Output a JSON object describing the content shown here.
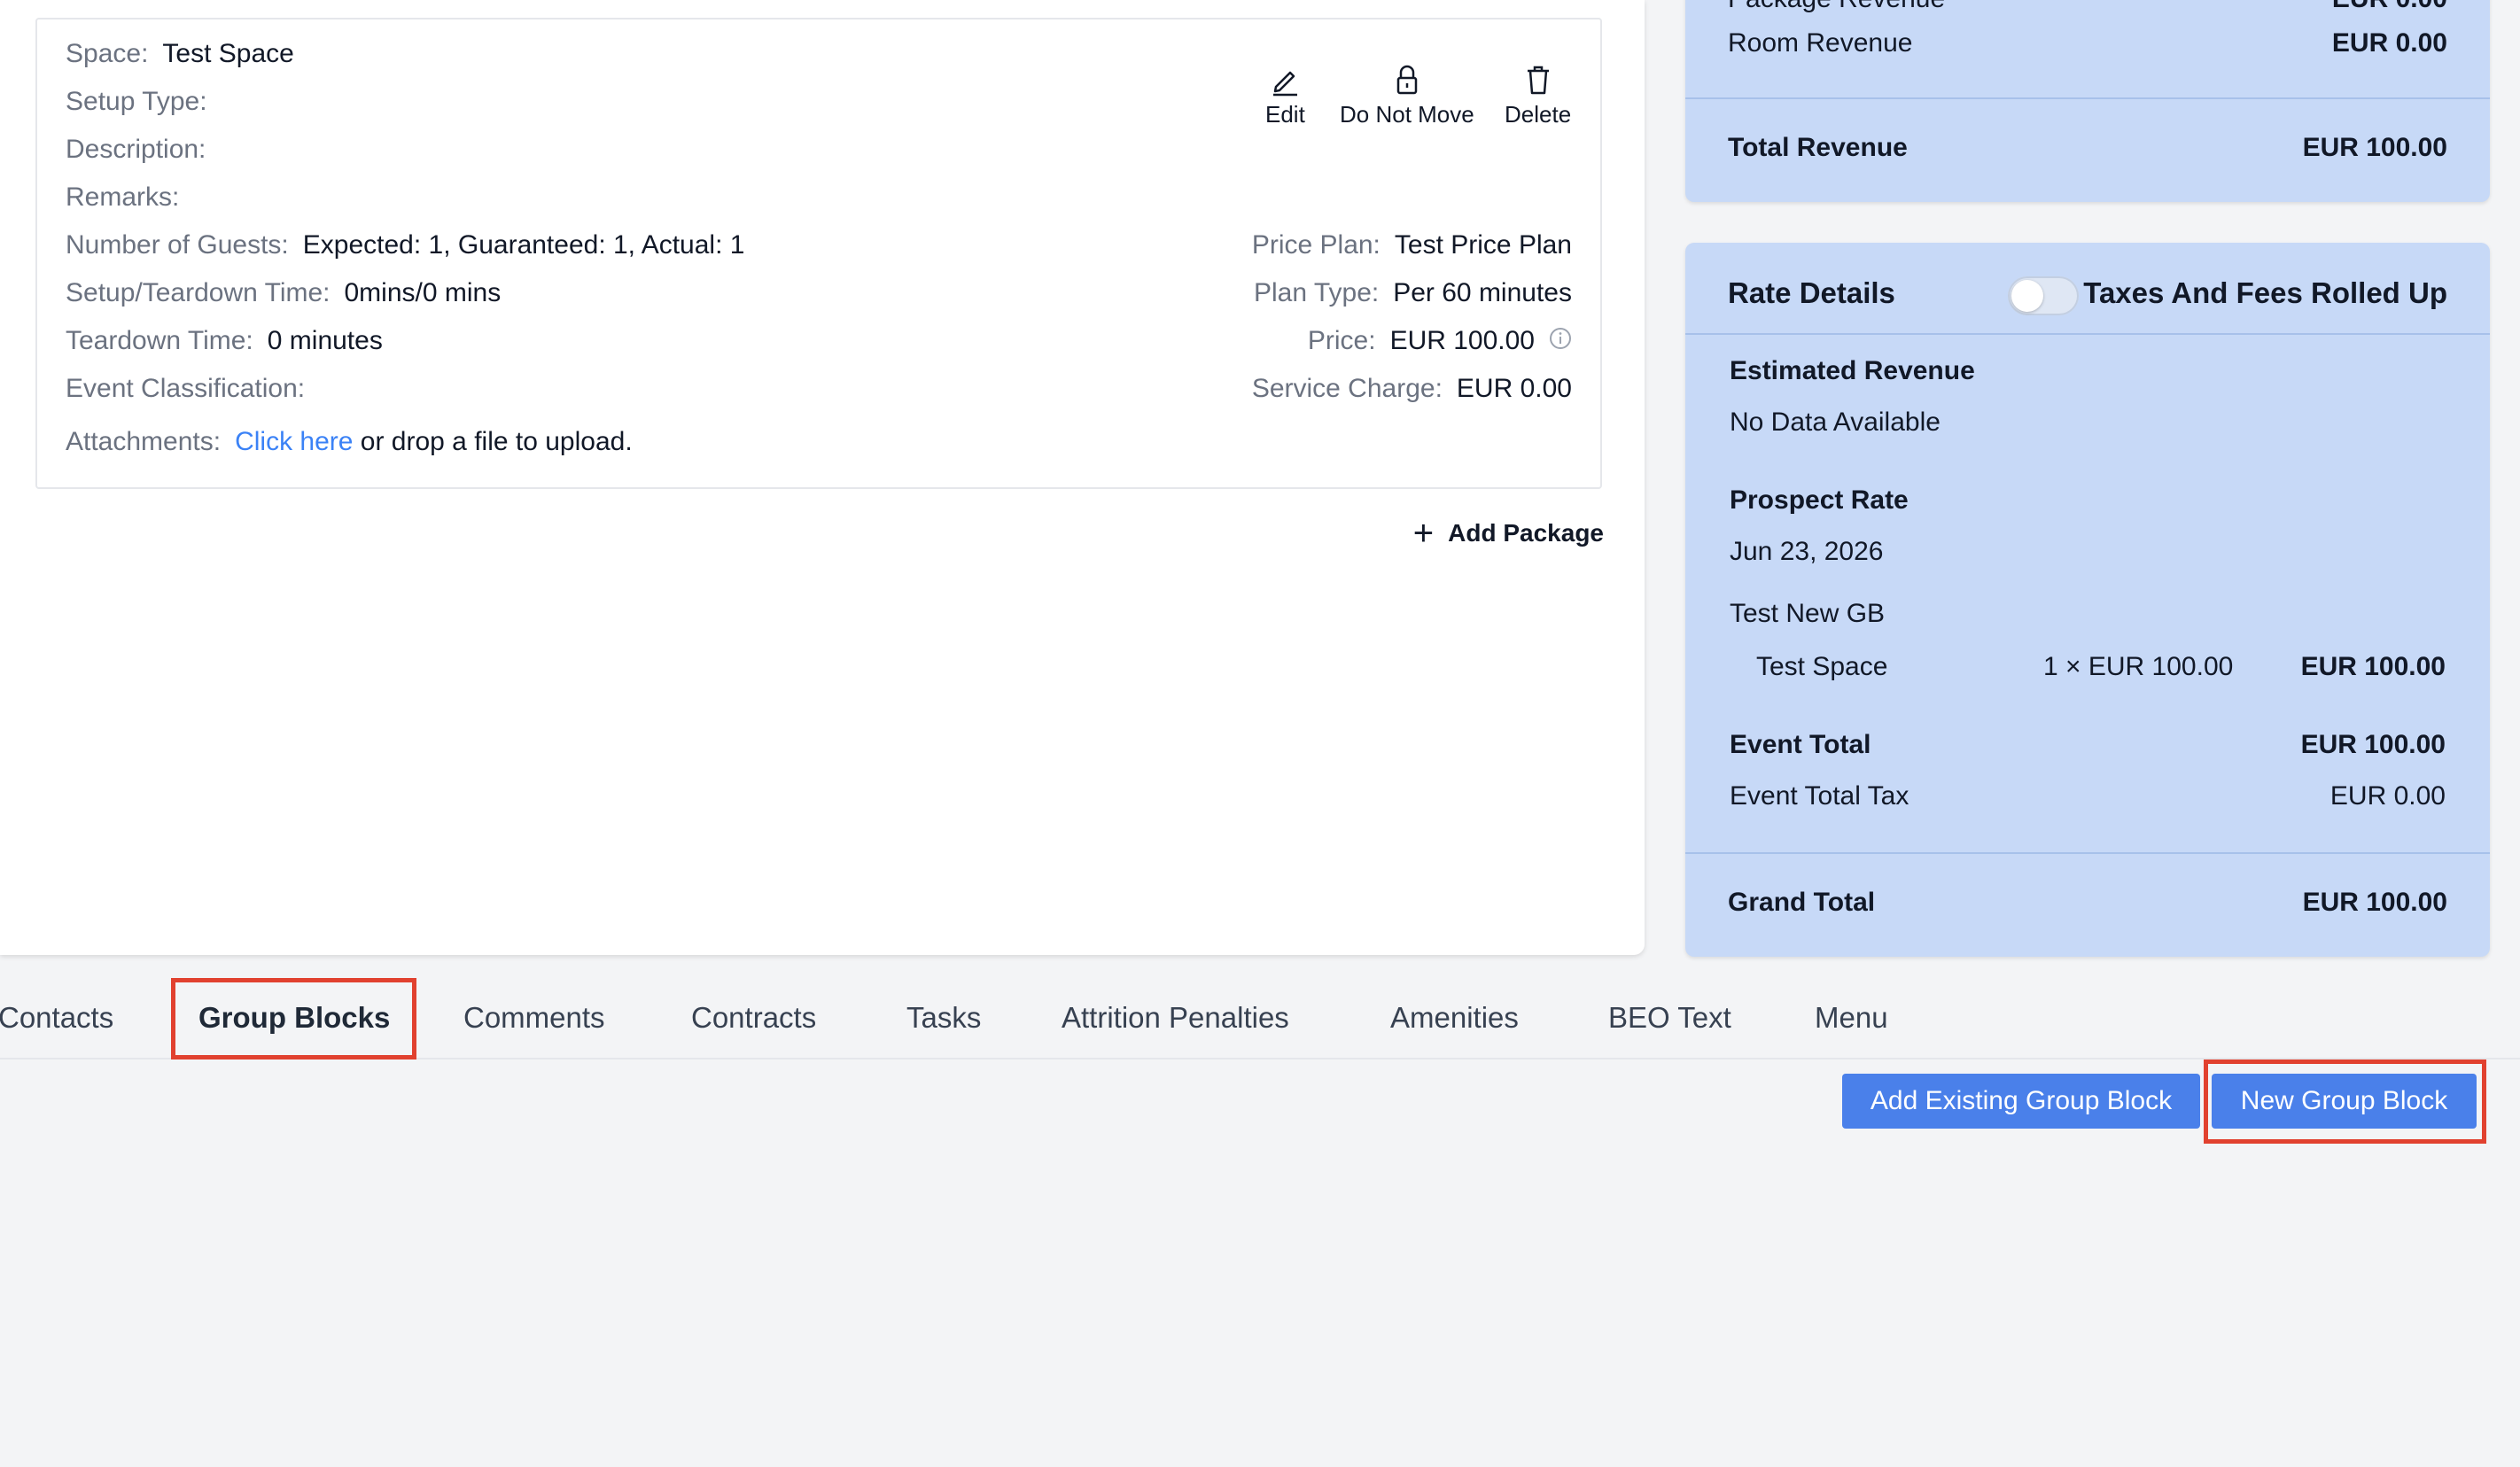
{
  "event": {
    "space_label": "Space:",
    "space_value": "Test Space",
    "setup_type_label": "Setup Type:",
    "description_label": "Description:",
    "remarks_label": "Remarks:",
    "guests_label": "Number of Guests:",
    "guests_value": "Expected: 1, Guaranteed: 1, Actual: 1",
    "setup_teardown_label": "Setup/Teardown Time:",
    "setup_teardown_value": "0mins/0 mins",
    "teardown_label": "Teardown Time:",
    "teardown_value": "0 minutes",
    "classification_label": "Event Classification:",
    "attachments_label": "Attachments:",
    "attachments_link": "Click here",
    "attachments_suffix": "or drop a file to upload.",
    "price_plan_label": "Price Plan:",
    "price_plan_value": "Test Price Plan",
    "plan_type_label": "Plan Type:",
    "plan_type_value": "Per 60 minutes",
    "price_label": "Price:",
    "price_value": "EUR 100.00",
    "service_charge_label": "Service Charge:",
    "service_charge_value": "EUR 0.00",
    "actions": {
      "edit": "Edit",
      "do_not_move": "Do Not Move",
      "delete": "Delete"
    },
    "add_package": "Add Package"
  },
  "revenue": {
    "package_label": "Package Revenue",
    "package_value": "EUR 0.00",
    "room_label": "Room Revenue",
    "room_value": "EUR 0.00",
    "total_label": "Total Revenue",
    "total_value": "EUR 100.00"
  },
  "rate_details": {
    "title": "Rate Details",
    "toggle_label": "Taxes And Fees Rolled Up",
    "toggle_on": false,
    "estimated_revenue_label": "Estimated Revenue",
    "estimated_revenue_value": "No Data Available",
    "prospect_rate_label": "Prospect Rate",
    "prospect_date": "Jun 23, 2026",
    "group_name": "Test New GB",
    "line_item": {
      "name": "Test Space",
      "qty": "1 × EUR 100.00",
      "amount": "EUR 100.00"
    },
    "event_total_label": "Event Total",
    "event_total_value": "EUR 100.00",
    "event_tax_label": "Event Total Tax",
    "event_tax_value": "EUR 0.00",
    "grand_total_label": "Grand Total",
    "grand_total_value": "EUR 100.00"
  },
  "tabs": [
    {
      "label": "Contacts"
    },
    {
      "label": "Group Blocks",
      "active": true
    },
    {
      "label": "Comments"
    },
    {
      "label": "Contracts"
    },
    {
      "label": "Tasks"
    },
    {
      "label": "Attrition Penalties"
    },
    {
      "label": "Amenities"
    },
    {
      "label": "BEO Text"
    },
    {
      "label": "Menu"
    }
  ],
  "buttons": {
    "add_existing": "Add Existing Group Block",
    "new_group_block": "New Group Block"
  },
  "colors": {
    "accent": "#4a80ea",
    "panel": "#c7d9f7",
    "highlight": "#e1412f",
    "link": "#3b82f6"
  }
}
